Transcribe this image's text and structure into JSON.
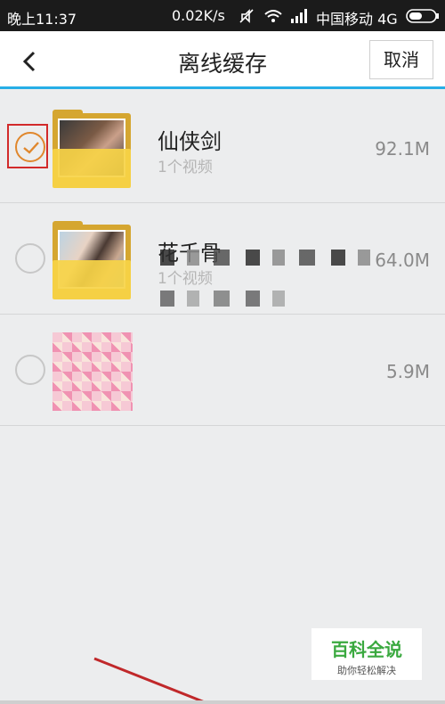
{
  "status_bar": {
    "time": "晚上11:37",
    "speed": "0.02K/s",
    "carrier": "中国移动 4G"
  },
  "header": {
    "title": "离线缓存",
    "cancel_label": "取消",
    "accent_color": "#27aee6"
  },
  "items": [
    {
      "title": "仙侠剑",
      "subtitle": "1个视频",
      "size": "92.1M",
      "checked": true
    },
    {
      "title": "花千骨",
      "subtitle": "1个视频",
      "size": "64.0M",
      "checked": false
    },
    {
      "title": "",
      "subtitle": "",
      "size": "5.9M",
      "checked": false
    }
  ],
  "watermark": {
    "main": "百科全说",
    "sub": "助你轻松解决"
  },
  "colors": {
    "check_orange": "#e0872d",
    "highlight_red": "#d22a2a",
    "folder_yellow": "#f7d446"
  }
}
